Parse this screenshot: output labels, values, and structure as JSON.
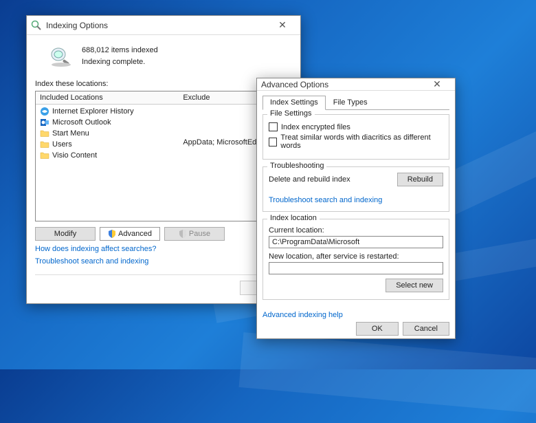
{
  "indexing": {
    "title": "Indexing Options",
    "items_indexed": "688,012 items indexed",
    "status": "Indexing complete.",
    "section_label": "Index these locations:",
    "columns": {
      "included": "Included Locations",
      "exclude": "Exclude"
    },
    "locations": [
      {
        "icon": "ie",
        "label": "Internet Explorer History"
      },
      {
        "icon": "outlook",
        "label": "Microsoft Outlook"
      },
      {
        "icon": "folder",
        "label": "Start Menu"
      },
      {
        "icon": "folder",
        "label": "Users"
      },
      {
        "icon": "folder",
        "label": "Visio Content"
      }
    ],
    "exclude_text": "AppData; MicrosoftEdgeBackup",
    "buttons": {
      "modify": "Modify",
      "advanced": "Advanced",
      "pause": "Pause"
    },
    "links": {
      "affect": "How does indexing affect searches?",
      "troubleshoot": "Troubleshoot search and indexing"
    }
  },
  "advanced": {
    "title": "Advanced Options",
    "tabs": {
      "index": "Index Settings",
      "file": "File Types"
    },
    "file_settings": {
      "legend": "File Settings",
      "encrypted": "Index encrypted files",
      "diacritics": "Treat similar words with diacritics as different words"
    },
    "troubleshooting": {
      "legend": "Troubleshooting",
      "delete_label": "Delete and rebuild index",
      "rebuild": "Rebuild",
      "link": "Troubleshoot search and indexing"
    },
    "index_location": {
      "legend": "Index location",
      "current_label": "Current location:",
      "current_value": "C:\\ProgramData\\Microsoft",
      "new_label": "New location, after service is restarted:",
      "select_new": "Select new"
    },
    "help_link": "Advanced indexing help",
    "ok": "OK",
    "cancel": "Cancel"
  }
}
